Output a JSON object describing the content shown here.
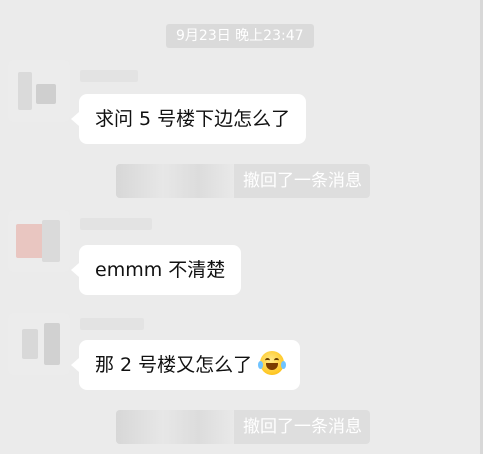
{
  "chat": {
    "timestamp": "9月23日 晚上23:47",
    "messages": [
      {
        "text": "求问 5 号楼下边怎么了"
      },
      {
        "recall_text": "撤回了一条消息"
      },
      {
        "text": "emmm 不清楚"
      },
      {
        "text": "那 2 号楼又怎么了",
        "emoji": "tears-of-joy-icon"
      },
      {
        "recall_text": "撤回了一条消息"
      }
    ]
  },
  "colors": {
    "background": "#ebebeb",
    "bubble": "#ffffff",
    "system_pill": "#dadada",
    "system_text": "#ffffff"
  }
}
